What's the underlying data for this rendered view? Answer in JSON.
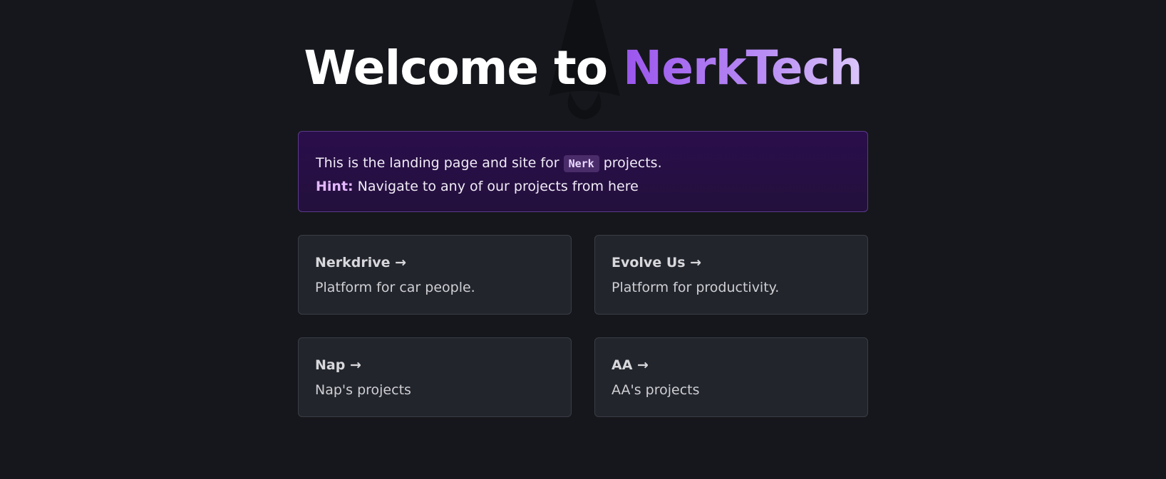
{
  "header": {
    "title_prefix": "Welcome to ",
    "title_brand": "NerkTech"
  },
  "callout": {
    "text_before": "This is the landing page and site for ",
    "code": "Nerk",
    "text_after": " projects.",
    "hint_label": "Hint:",
    "hint_text": " Navigate to any of our projects from here"
  },
  "cards": [
    {
      "title": "Nerkdrive →",
      "description": "Platform for car people."
    },
    {
      "title": "Evolve Us →",
      "description": "Platform for productivity."
    },
    {
      "title": "Nap →",
      "description": "Nap's projects"
    },
    {
      "title": "AA →",
      "description": "AA's projects"
    }
  ],
  "colors": {
    "background": "#16171c",
    "brand_gradient_start": "#9b55ee",
    "brand_gradient_end": "#dcc6fa",
    "card_bg": "#22252c",
    "callout_bg": "#2a0e4c"
  },
  "icons": {
    "background_logo": "astro-logo-icon"
  }
}
